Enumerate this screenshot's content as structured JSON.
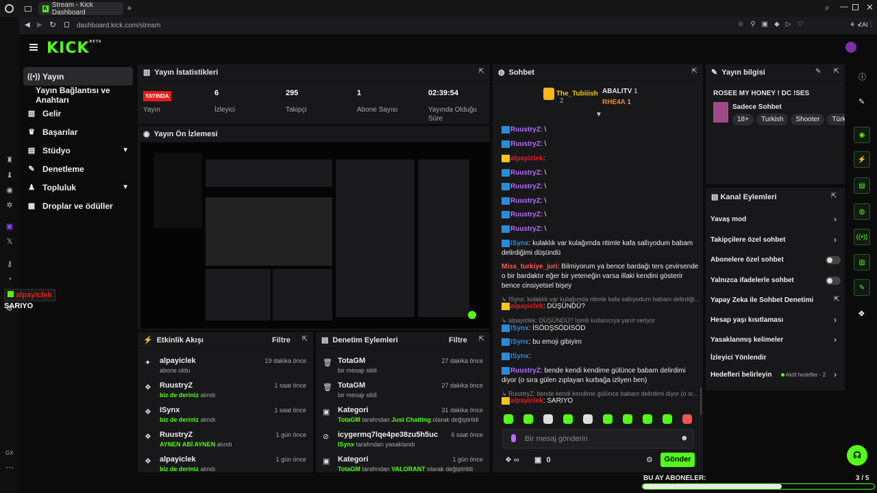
{
  "browser": {
    "tab_title": "Stream - Kick Dashboard",
    "url": "dashboard.kick.com/stream"
  },
  "logo": {
    "text": "KICK",
    "beta": "BETA"
  },
  "nav": {
    "items": [
      {
        "label": "Yayın",
        "icon": "broadcast-icon"
      },
      {
        "label": "Yayın Bağlantısı ve Anahtarı",
        "icon": ""
      },
      {
        "label": "Gelir",
        "icon": "revenue-icon"
      },
      {
        "label": "Başarılar",
        "icon": "trophy-icon"
      },
      {
        "label": "Stüdyo",
        "icon": "studio-icon"
      },
      {
        "label": "Denetleme",
        "icon": "wrench-icon"
      },
      {
        "label": "Topluluk",
        "icon": "community-icon"
      },
      {
        "label": "Droplar ve ödüller",
        "icon": "drops-icon"
      }
    ]
  },
  "stats": {
    "title": "Yayın İstatistikleri",
    "live_badge": "YAYINDA",
    "live_label": "Yayın",
    "items": [
      {
        "value": "6",
        "label": "İzleyici"
      },
      {
        "value": "295",
        "label": "Takipçi"
      },
      {
        "value": "1",
        "label": "Abone Sayısı"
      },
      {
        "value": "02:39:54",
        "label": "Yayında Olduğu Süre"
      }
    ]
  },
  "preview": {
    "title": "Yayın Ön İzlemesi"
  },
  "overlay": {
    "user": "alpayiclek",
    "caption": "SARIYO",
    "gx": "GX"
  },
  "activity": {
    "title": "Etkinlik Akışı",
    "filter": "Filtre",
    "rows": [
      {
        "name": "alpayiclek",
        "sub": "abone oldu",
        "highlight": "",
        "suffix": "",
        "time": "19 dakika önce"
      },
      {
        "name": "RuustryZ",
        "sub": "",
        "highlight": "biz de deriniz",
        "suffix": "alındı",
        "time": "1 saat önce"
      },
      {
        "name": "ISynx",
        "sub": "",
        "highlight": "biz de deriniz",
        "suffix": "alındı",
        "time": "1 saat önce"
      },
      {
        "name": "RuustryZ",
        "sub": "",
        "highlight": "AYNEN ABİ AYNEN",
        "suffix": "alındı",
        "time": "1 gün önce"
      },
      {
        "name": "alpayiclek",
        "sub": "",
        "highlight": "biz de deriniz",
        "suffix": "alındı",
        "time": "1 gün önce"
      }
    ]
  },
  "moderation": {
    "title": "Denetim Eylemleri",
    "filter": "Filtre",
    "rows": [
      {
        "name": "TotaGM",
        "pre": "",
        "hl1": "",
        "mid": "bir mesajı sildi",
        "hl2": "",
        "post": "",
        "time": "27 dakika önce"
      },
      {
        "name": "TotaGM",
        "pre": "",
        "hl1": "",
        "mid": "bir mesajı sildi",
        "hl2": "",
        "post": "",
        "time": "27 dakika önce"
      },
      {
        "name": "Kategori",
        "pre": "",
        "hl1": "TotaGM",
        "mid": " tarafından ",
        "hl2": "Just Chatting",
        "post": " olarak değiştirildi",
        "time": "31 dakika önce"
      },
      {
        "name": "icygermq7lqe4pe38zu5h5uc",
        "pre": "",
        "hl1": "ISynx",
        "mid": " tarafından yasaklandı",
        "hl2": "",
        "post": "",
        "time": "6 saat önce"
      },
      {
        "name": "Kategori",
        "pre": "",
        "hl1": "TotaGM",
        "mid": " tarafından ",
        "hl2": "VALORANT",
        "post": " olarak değiştirildi",
        "time": "1 gün önce"
      }
    ]
  },
  "chat": {
    "title": "Sohbet",
    "leaders": [
      {
        "name": "The_Tubiiish",
        "count": "2"
      },
      {
        "name": "ABALITV",
        "count": "1"
      },
      {
        "name": "RHE4A",
        "count": "1"
      }
    ],
    "messages": [
      {
        "user": "RuustryZ",
        "color": "#b56cff",
        "badge": "blue",
        "text": ": \\"
      },
      {
        "user": "RuustryZ",
        "color": "#b56cff",
        "badge": "blue",
        "text": ": \\"
      },
      {
        "user": "alpayiclek",
        "color": "#e0201b",
        "badge": "gold",
        "text": ":"
      },
      {
        "user": "RuustryZ",
        "color": "#b56cff",
        "badge": "blue",
        "text": ": \\"
      },
      {
        "user": "RuustryZ",
        "color": "#b56cff",
        "badge": "blue",
        "text": ": \\"
      },
      {
        "user": "RuustryZ",
        "color": "#b56cff",
        "badge": "blue",
        "text": ": \\"
      },
      {
        "user": "RuustryZ",
        "color": "#b56cff",
        "badge": "blue",
        "text": ": \\"
      },
      {
        "user": "RuustryZ",
        "color": "#b56cff",
        "badge": "blue",
        "text": ": \\"
      },
      {
        "user": "ISynx",
        "color": "#2a8bd8",
        "badge": "blue",
        "text": ": kulaklık var kulağımda ritimle kafa sallıyodum babam delirdiğimi düşündü"
      },
      {
        "user": "Miss_turkiye_juri",
        "color": "#ff5a5a",
        "badge": "",
        "text": ": Bilmiyorum ya bence bardağı ters çevirsende o bir bardaktır eğer bir yeteneğin varsa illaki kendini gösterir bence cinsiyetsel bişey"
      },
      {
        "user": "",
        "color": "#888",
        "badge": "",
        "text": "↳ ISynx: kulaklık var kulağımda ritimle kafa sallıyodum babam delirdiği..."
      },
      {
        "user": "alpayiclek",
        "color": "#e0201b",
        "badge": "gold",
        "text": ": DÜŞÜNDÜ?"
      },
      {
        "user": "",
        "color": "#888",
        "badge": "",
        "text": "↳ alpayiclek: DÜŞÜNDÜ? İsimli kullanıcıya yanıt veriyor"
      },
      {
        "user": "ISynx",
        "color": "#2a8bd8",
        "badge": "blue",
        "text": ": İSÖDŞSÖDİSÖD"
      },
      {
        "user": "ISynx",
        "color": "#2a8bd8",
        "badge": "blue",
        "text": ": bu emoji gibiyim"
      },
      {
        "user": "ISynx",
        "color": "#2a8bd8",
        "badge": "blue",
        "text": ":"
      },
      {
        "user": "RuustryZ",
        "color": "#b56cff",
        "badge": "blue",
        "text": ": bende kendi kendime gülünce babam delirdimi diyor (o sıra gülen zıplayan kurbağa izliyen ben)"
      },
      {
        "user": "",
        "color": "#888",
        "badge": "",
        "text": "↳ RuustryZ: bende kendi kendime gülünce babam delirdimi diyor (o sr..."
      },
      {
        "user": "alpayiclek",
        "color": "#e0201b",
        "badge": "gold",
        "text": ": SARIYO"
      }
    ],
    "input_placeholder": "Bir mesaj gönderin",
    "send_label": "Gönder",
    "points": "∞",
    "gifts": "0"
  },
  "stream_info": {
    "title": "Yayın bilgisi",
    "stream_title": "ROSEE MY HONEY ! DC !SES",
    "category": "Sadece Sohbet",
    "tags": [
      "18+",
      "Turkish",
      "Shooter",
      "Türk"
    ]
  },
  "channel_actions": {
    "title": "Kanal Eylemleri",
    "rows": [
      {
        "label": "Yavaş mod",
        "control": "arrow"
      },
      {
        "label": "Takipçilere özel sohbet",
        "control": "arrow"
      },
      {
        "label": "Abonelere özel sohbet",
        "control": "toggle"
      },
      {
        "label": "Yalnızca ifadelerle sohbet",
        "control": "toggle"
      },
      {
        "label": "Yapay Zeka ile Sohbet Denetimi",
        "control": "external"
      },
      {
        "label": "Hesap yaşı kısıtlaması",
        "control": "arrow"
      },
      {
        "label": "Yasaklanmış kelimeler",
        "control": "arrow"
      },
      {
        "label": "İzleyici Yönlendir",
        "control": "none"
      },
      {
        "label": "Hedefleri belirleyin",
        "control": "arrow"
      }
    ],
    "goals_status": "Aktif hedefler - 2"
  },
  "sub_goal": {
    "label": "BU AY ABONELER:",
    "progress": "3 / 5",
    "fraction": 0.6
  },
  "colors": {
    "accent": "#53fc18",
    "live": "#e0201b",
    "panel": "#18181a"
  }
}
